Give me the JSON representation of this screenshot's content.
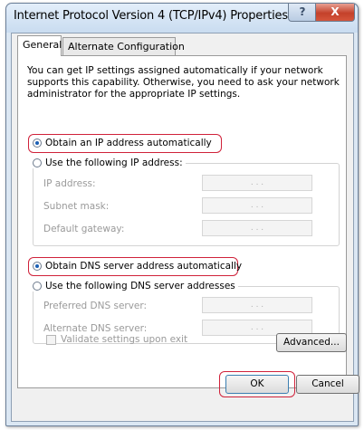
{
  "window": {
    "title": "Internet Protocol Version 4 (TCP/IPv4) Properties",
    "help_glyph": "?",
    "close_glyph": "X"
  },
  "tabs": [
    {
      "label": "General",
      "selected": true
    },
    {
      "label": "Alternate Configuration",
      "selected": false
    }
  ],
  "description": "You can get IP settings assigned automatically if your network supports this capability. Otherwise, you need to ask your network administrator for the appropriate IP settings.",
  "ip_section": {
    "option_auto": {
      "label": "Obtain an IP address automatically",
      "selected": true
    },
    "option_manual": {
      "label": "Use the following IP address:",
      "selected": false
    },
    "fields": [
      {
        "label": "IP address:",
        "value": ". . ."
      },
      {
        "label": "Subnet mask:",
        "value": ". . ."
      },
      {
        "label": "Default gateway:",
        "value": ". . ."
      }
    ]
  },
  "dns_section": {
    "option_auto": {
      "label": "Obtain DNS server address automatically",
      "selected": true
    },
    "option_manual": {
      "label": "Use the following DNS server addresses",
      "selected": false
    },
    "fields": [
      {
        "label": "Preferred DNS server:",
        "value": ". . ."
      },
      {
        "label": "Alternate DNS server:",
        "value": ". . ."
      }
    ]
  },
  "validate_checkbox": {
    "label": "Validate settings upon exit",
    "checked": false
  },
  "buttons": {
    "advanced": "Advanced...",
    "ok": "OK",
    "cancel": "Cancel"
  },
  "colors": {
    "highlight": "#d0223a",
    "close_button": "#c4412a",
    "window_frame": "#dbe7f3"
  }
}
